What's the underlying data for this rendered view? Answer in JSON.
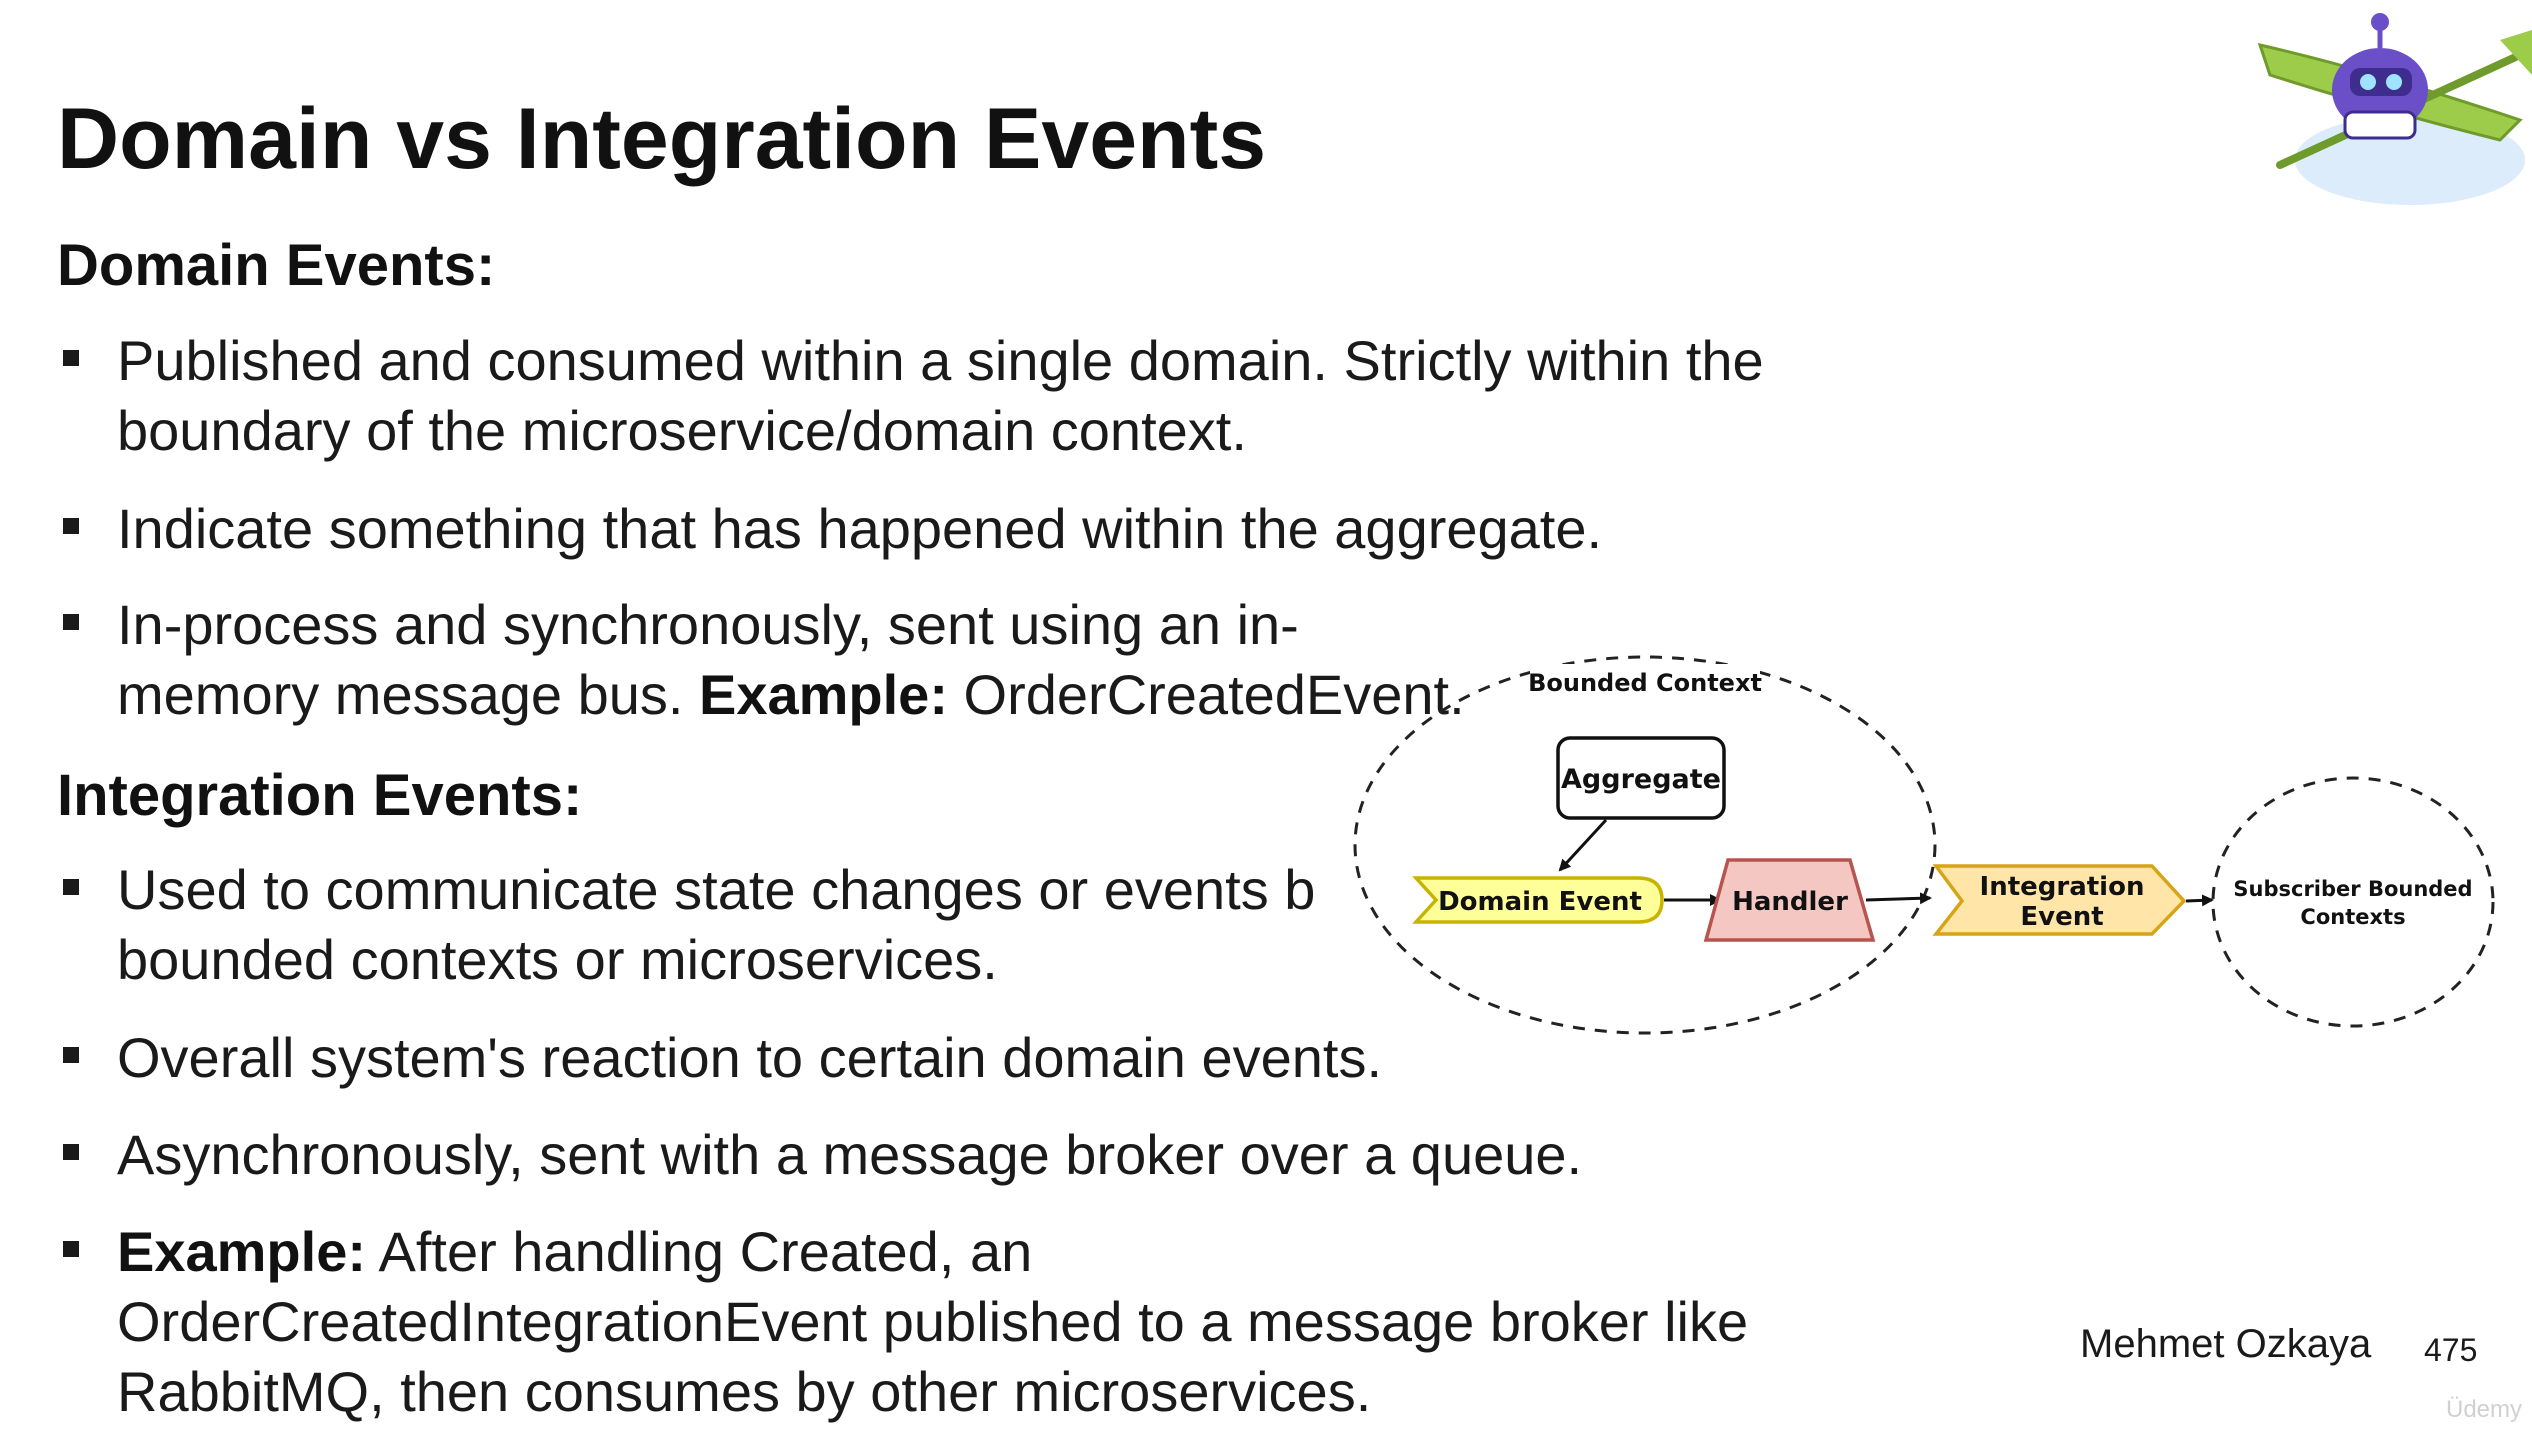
{
  "slide": {
    "title": "Domain vs Integration Events",
    "author": "Mehmet Ozkaya",
    "page_number": "475",
    "watermark": "Üdemy"
  },
  "domain_events": {
    "heading": "Domain Events:",
    "bullets": [
      {
        "text": "Published and consumed within a single domain. Strictly within the boundary of the microservice/domain context."
      },
      {
        "text": "Indicate something that has happened within the aggregate."
      },
      {
        "text": "In-process and synchronously, sent using an in-memory message bus. ",
        "bold": "Example:",
        "after": " OrderCreatedEvent."
      }
    ]
  },
  "integration_events": {
    "heading": "Integration Events:",
    "bullets": [
      {
        "text": "Used to communicate state changes or events b"
      },
      {
        "text_line2": "bounded contexts or microservices."
      },
      {
        "text": "Overall system's reaction to certain domain events."
      },
      {
        "text": "Asynchronously, sent with a message broker over a queue."
      },
      {
        "bold": "Example:",
        "after": " After handling Created, an OrderCreatedIntegrationEvent published to a message broker like RabbitMQ, then consumes by other microservices."
      }
    ]
  },
  "diagram": {
    "bounded_context_label": "Bounded Context",
    "aggregate": "Aggregate",
    "domain_event": "Domain Event",
    "handler": "Handler",
    "integration_event_line1": "Integration",
    "integration_event_line2": "Event",
    "subscriber_line1": "Subscriber Bounded",
    "subscriber_line2": "Contexts",
    "colors": {
      "domain_event_fill": "#ffff99",
      "domain_event_stroke": "#c8b400",
      "handler_fill": "#f4c7c3",
      "handler_stroke": "#b85450",
      "integration_fill": "#ffe6a8",
      "integration_stroke": "#d6a417"
    }
  },
  "mascot": {
    "icon": "kayak-robot-icon"
  }
}
